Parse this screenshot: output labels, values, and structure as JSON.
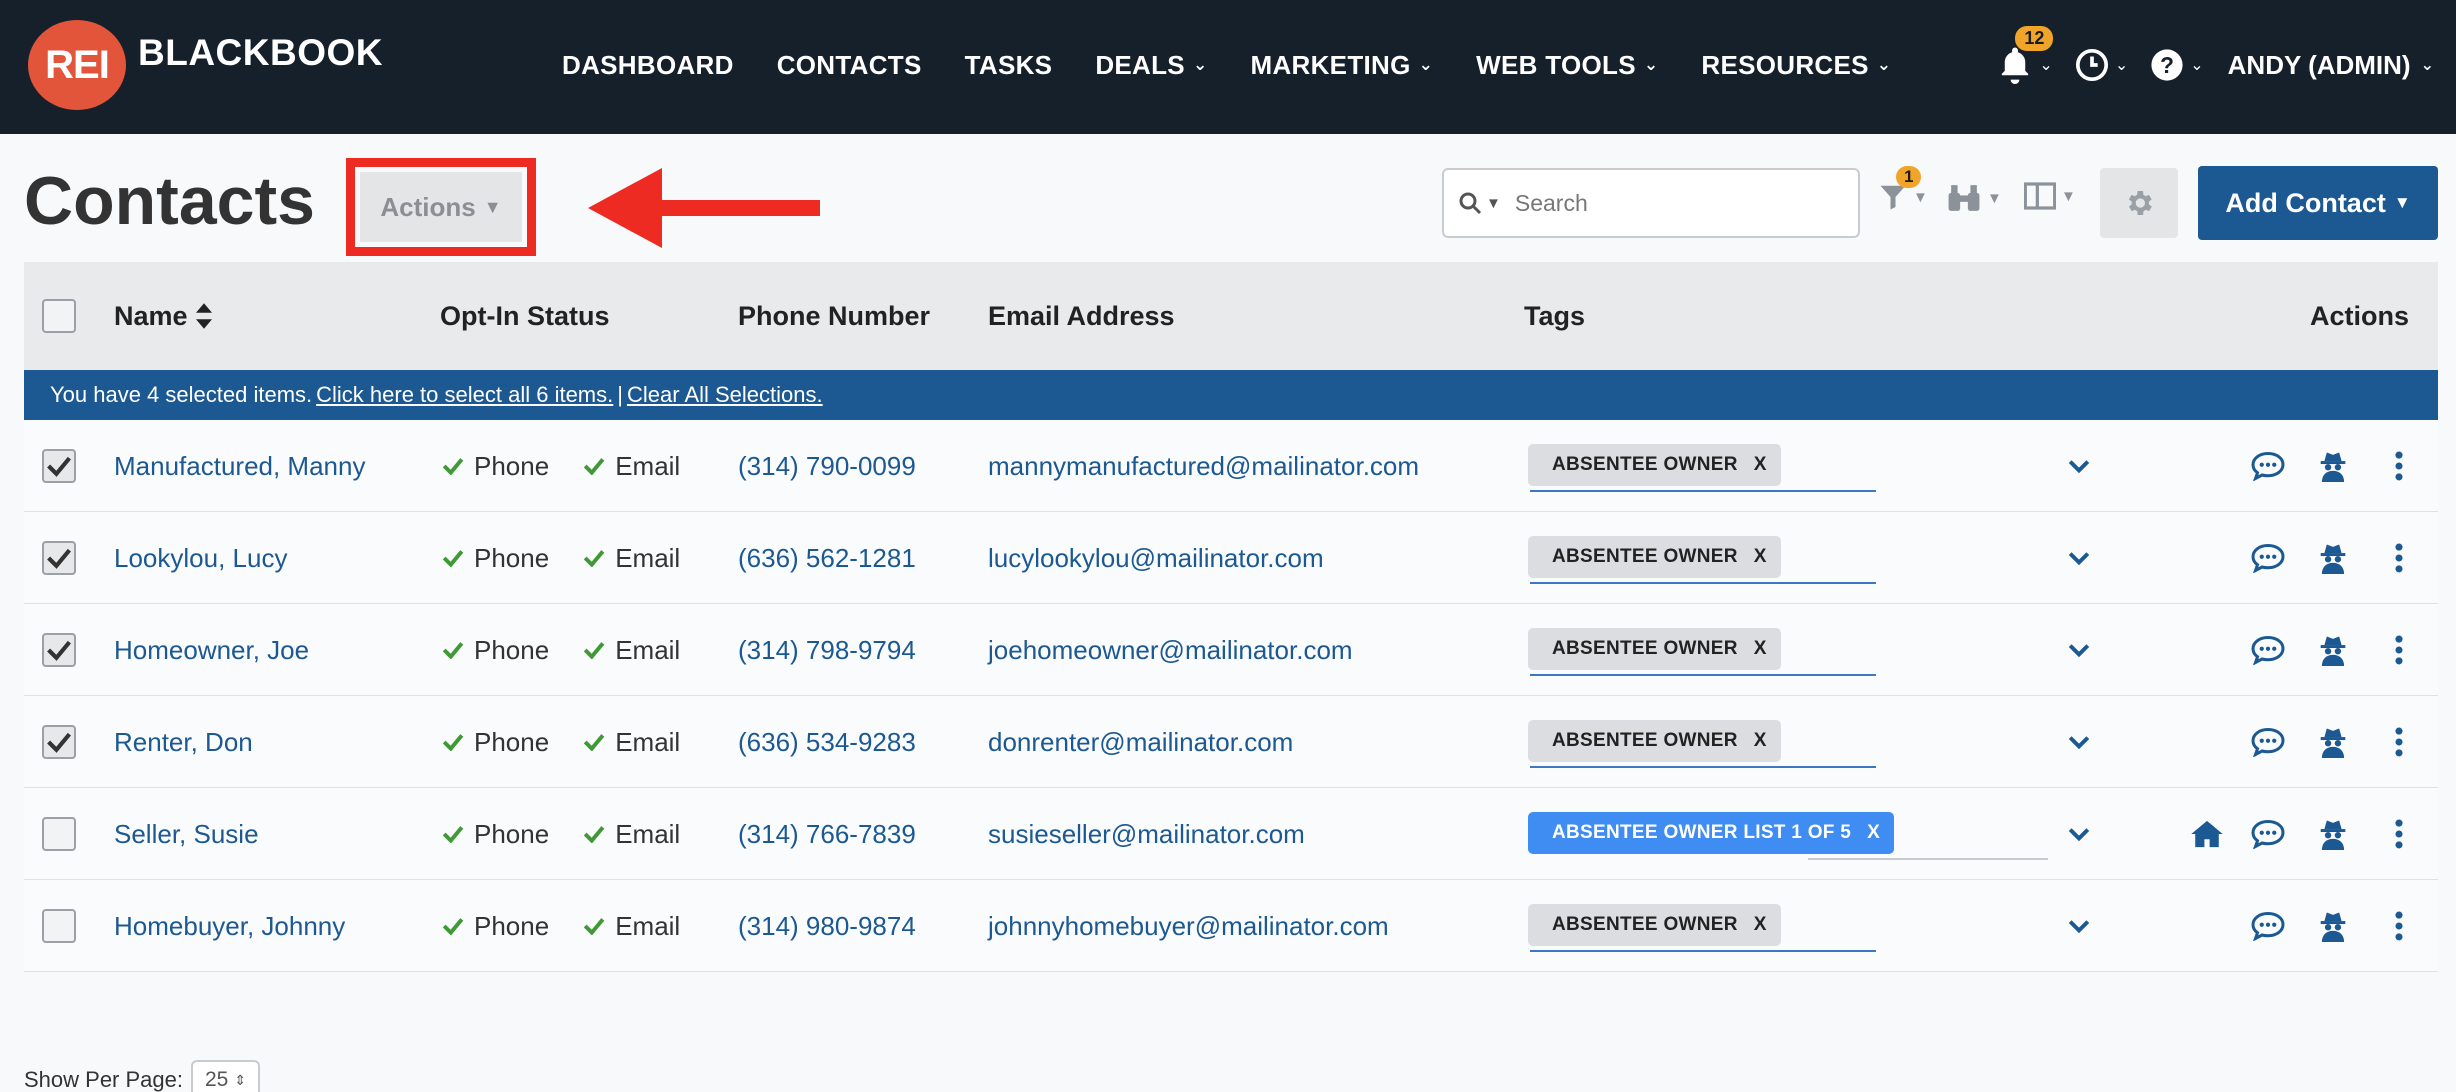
{
  "brand": {
    "badge": "REI",
    "name": "BLACKBOOK"
  },
  "nav": {
    "items": [
      {
        "label": "DASHBOARD",
        "dropdown": false
      },
      {
        "label": "CONTACTS",
        "dropdown": false
      },
      {
        "label": "TASKS",
        "dropdown": false
      },
      {
        "label": "DEALS",
        "dropdown": true
      },
      {
        "label": "MARKETING",
        "dropdown": true
      },
      {
        "label": "WEB TOOLS",
        "dropdown": true
      },
      {
        "label": "RESOURCES",
        "dropdown": true
      }
    ],
    "notifications_count": "12",
    "user": "ANDY (ADMIN)"
  },
  "page": {
    "title": "Contacts",
    "actions_label": "Actions",
    "search_placeholder": "Search",
    "filter_count": "1",
    "add_contact_label": "Add Contact"
  },
  "table": {
    "headers": {
      "name": "Name",
      "opt_in": "Opt-In Status",
      "phone": "Phone Number",
      "email": "Email Address",
      "tags": "Tags",
      "actions": "Actions"
    },
    "selection": {
      "prefix": "You have 4 selected items.",
      "select_all": "Click here to select all 6 items.",
      "separator": "|",
      "clear": "Clear All Selections."
    },
    "opt_phone": "Phone",
    "opt_email": "Email",
    "rows": [
      {
        "name": "Manufactured, Manny",
        "phone": "(314) 790-0099",
        "email": "mannymanufactured@mailinator.com",
        "tag": "ABSENTEE OWNER",
        "checked": true,
        "home": false
      },
      {
        "name": "Lookylou, Lucy",
        "phone": "(636) 562-1281",
        "email": "lucylookylou@mailinator.com",
        "tag": "ABSENTEE OWNER",
        "checked": true,
        "home": false
      },
      {
        "name": "Homeowner, Joe",
        "phone": "(314) 798-9794",
        "email": "joehomeowner@mailinator.com",
        "tag": "ABSENTEE OWNER",
        "checked": true,
        "home": false
      },
      {
        "name": "Renter, Don",
        "phone": "(636) 534-9283",
        "email": "donrenter@mailinator.com",
        "tag": "ABSENTEE OWNER",
        "checked": true,
        "home": false
      },
      {
        "name": "Seller, Susie",
        "phone": "(314) 766-7839",
        "email": "susieseller@mailinator.com",
        "tag": "ABSENTEE OWNER LIST 1 OF 5",
        "checked": false,
        "home": true
      },
      {
        "name": "Homebuyer, Johnny",
        "phone": "(314) 980-9874",
        "email": "johnnyhomebuyer@mailinator.com",
        "tag": "ABSENTEE OWNER",
        "checked": false,
        "home": false
      }
    ],
    "tag_remove": "X"
  },
  "footer": {
    "per_page_label": "Show Per Page:",
    "per_page_value": "25"
  },
  "colors": {
    "nav_bg": "#16202b",
    "brand_red": "#e2553b",
    "primary": "#1c5892",
    "badge": "#f0a52a",
    "highlight": "#ee2b23",
    "tag_blue": "#3f8cf3"
  }
}
